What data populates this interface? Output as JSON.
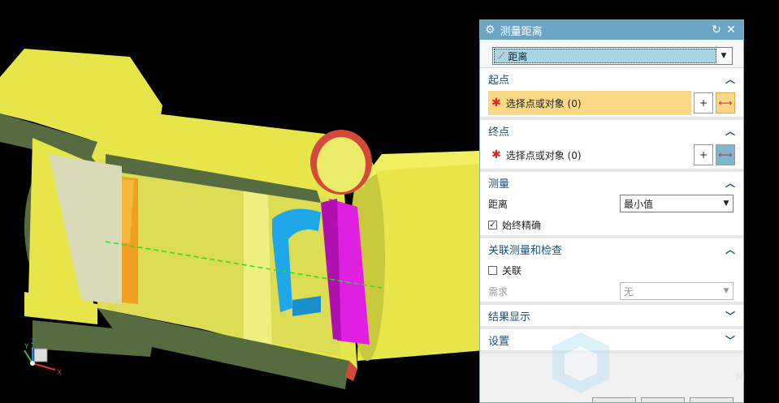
{
  "dialog": {
    "title": "测量距离",
    "type_value": "距离",
    "start": {
      "header": "起点",
      "select_label": "选择点或对象 (0)"
    },
    "end": {
      "header": "终点",
      "select_label": "选择点或对象 (0)"
    },
    "measure": {
      "header": "测量",
      "distance_label": "距离",
      "distance_value": "最小值",
      "always_exact_label": "始终精确",
      "always_exact_checked": true
    },
    "assoc": {
      "header": "关联测量和检查",
      "assoc_label": "关联",
      "assoc_checked": false,
      "need_label": "需求",
      "need_value": "无"
    },
    "result_header": "结果显示",
    "settings_header": "设置"
  },
  "axes": {
    "x": "X",
    "y": "Y",
    "z": "Z"
  },
  "watermark": "M",
  "colors": {
    "titlebar": "#6aa6c3",
    "highlight": "#fbd885",
    "model_yellow": "#e8e84a",
    "model_shadow": "#566b3f",
    "magenta": "#e020e0",
    "cyan": "#1fa8e8",
    "orange": "#f0a020"
  }
}
